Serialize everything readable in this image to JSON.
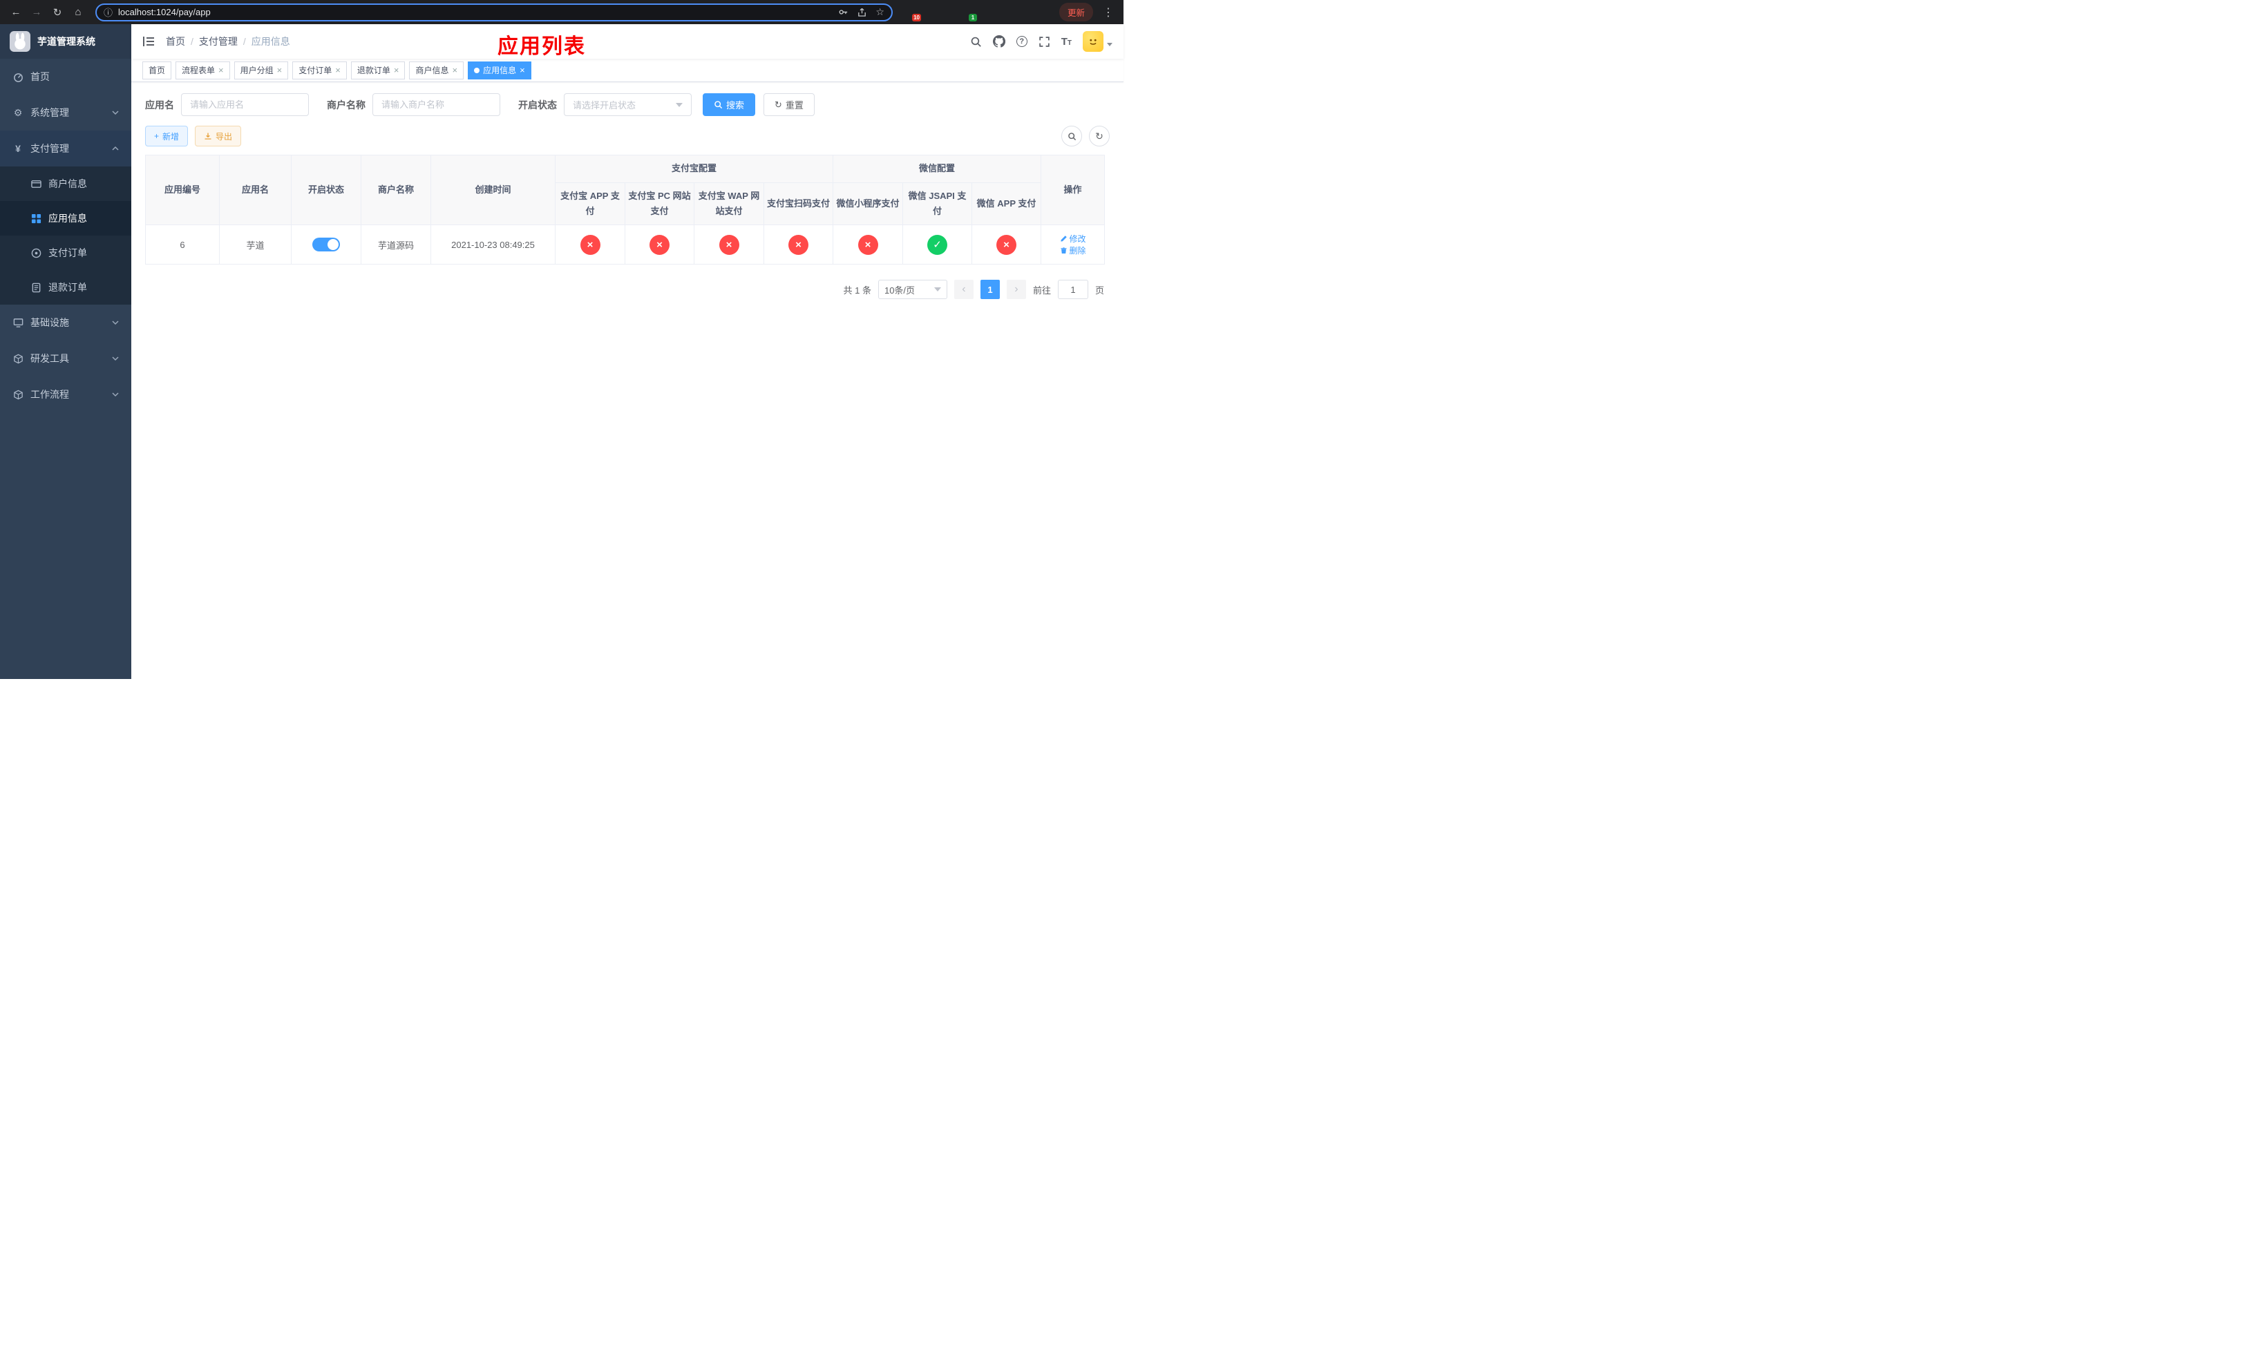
{
  "colors": {
    "primary": "#409eff",
    "success": "#13ce66",
    "danger": "#ff4949",
    "warning": "#e6a23c",
    "title_red": "#f60000",
    "sidebar_bg": "#304156",
    "submenu_bg": "#1f2d3d"
  },
  "browser": {
    "url": "localhost:1024/pay/app",
    "update_button": "更新",
    "extensions": {
      "badge_1": "10",
      "badge_2": "1"
    }
  },
  "sidebar": {
    "logo_title": "芋道管理系统",
    "menu": [
      {
        "label": "首页",
        "icon": "dashboard-icon"
      },
      {
        "label": "系统管理",
        "icon": "gear-icon",
        "state": "collapsed"
      },
      {
        "label": "支付管理",
        "icon": "yen-icon",
        "state": "expanded"
      },
      {
        "label": "基础设施",
        "icon": "infrastructure-icon",
        "state": "collapsed"
      },
      {
        "label": "研发工具",
        "icon": "dev-tools-icon",
        "state": "collapsed"
      },
      {
        "label": "工作流程",
        "icon": "workflow-icon",
        "state": "collapsed"
      }
    ],
    "submenu_pay": [
      {
        "label": "商户信息",
        "icon": "merchant-card-icon",
        "active": false
      },
      {
        "label": "应用信息",
        "icon": "app-grid-icon",
        "active": true
      },
      {
        "label": "支付订单",
        "icon": "pay-order-icon",
        "active": false
      },
      {
        "label": "退款订单",
        "icon": "refund-order-icon",
        "active": false
      }
    ]
  },
  "header": {
    "breadcrumb": [
      "首页",
      "支付管理",
      "应用信息"
    ],
    "page_title": "应用列表"
  },
  "tabs": [
    {
      "label": "首页",
      "closable": false,
      "active": false
    },
    {
      "label": "流程表单",
      "closable": true,
      "active": false
    },
    {
      "label": "用户分组",
      "closable": true,
      "active": false
    },
    {
      "label": "支付订单",
      "closable": true,
      "active": false
    },
    {
      "label": "退款订单",
      "closable": true,
      "active": false
    },
    {
      "label": "商户信息",
      "closable": true,
      "active": false
    },
    {
      "label": "应用信息",
      "closable": true,
      "active": true
    }
  ],
  "filters": {
    "app_name_label": "应用名",
    "app_name_placeholder": "请输入应用名",
    "merchant_label": "商户名称",
    "merchant_placeholder": "请输入商户名称",
    "status_label": "开启状态",
    "status_placeholder": "请选择开启状态",
    "search_button": "搜索",
    "reset_button": "重置"
  },
  "toolbar": {
    "add_button": "新增",
    "export_button": "导出"
  },
  "table": {
    "columns": {
      "app_id": "应用编号",
      "app_name": "应用名",
      "status": "开启状态",
      "merchant": "商户名称",
      "created": "创建时间",
      "alipay_group": "支付宝配置",
      "alipay_app": "支付宝 APP 支付",
      "alipay_pc": "支付宝 PC 网站支付",
      "alipay_wap": "支付宝 WAP 网站支付",
      "alipay_qr": "支付宝扫码支付",
      "wechat_group": "微信配置",
      "wechat_mini": "微信小程序支付",
      "wechat_jsapi": "微信 JSAPI 支付",
      "wechat_app": "微信 APP 支付",
      "actions": "操作"
    },
    "rows": [
      {
        "app_id": "6",
        "app_name": "芋道",
        "status_enabled": true,
        "merchant": "芋道源码",
        "created": "2021-10-23 08:49:25",
        "channels": {
          "alipay_app": false,
          "alipay_pc": false,
          "alipay_wap": false,
          "alipay_qr": false,
          "wechat_mini": false,
          "wechat_jsapi": true,
          "wechat_app": false
        },
        "edit_label": "修改",
        "delete_label": "删除"
      }
    ]
  },
  "pagination": {
    "total": "共 1 条",
    "page_size": "10条/页",
    "current_page": "1",
    "goto_label": "前往",
    "goto_value": "1",
    "goto_suffix": "页"
  }
}
